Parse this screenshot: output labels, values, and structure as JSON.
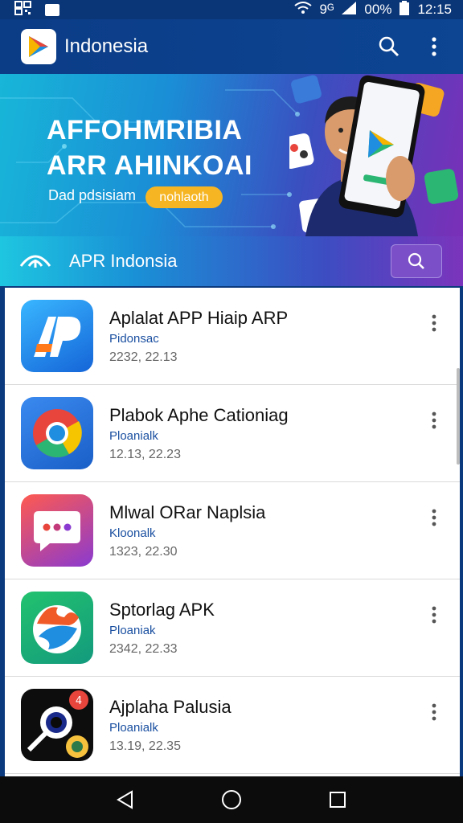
{
  "status_bar": {
    "signal_text": "9ᴳ",
    "battery_text": "00%",
    "time": "12:15"
  },
  "app_bar": {
    "title": "Indonesia"
  },
  "banner": {
    "headline_line1": "AFFOHMRIBIA",
    "headline_line2": "ARR AHINKOAI",
    "subtitle": "Dad pdsisiam",
    "pill_label": "nohlaoth"
  },
  "search_strip": {
    "title": "APR Indonsia"
  },
  "apps": [
    {
      "name": "Aplalat APP Hiaip ARP",
      "publisher": "Pidonsac",
      "date": "2232, 22.13",
      "icon": "ap-logo-icon",
      "colors": [
        "#2ba7f0",
        "#1565d8"
      ]
    },
    {
      "name": "Plabok Aphe Cationiag",
      "publisher": "Ploanialk",
      "date": "12.13, 22.23",
      "icon": "chrome-logo-icon",
      "colors": [
        "#2f7fe0",
        "#1a5fc8"
      ]
    },
    {
      "name": "Mlwal ORar Naplsia",
      "publisher": "Kloonalk",
      "date": "1323, 22.30",
      "icon": "chat-bubble-icon",
      "colors": [
        "#ff5a4f",
        "#8a3ad0"
      ]
    },
    {
      "name": "Sptorlag APK",
      "publisher": "Ploaniak",
      "date": "2342, 22.33",
      "icon": "photo-leaf-icon",
      "colors": [
        "#1fb26b",
        "#16a07f"
      ]
    },
    {
      "name": "Ajplaha Palusia",
      "publisher": "Ploanialk",
      "date": "13.19, 22.35",
      "icon": "camera-lens-icon",
      "colors": [
        "#111111",
        "#000000"
      ]
    }
  ],
  "colors": {
    "app_bar": "#0b3c86",
    "accent_pill": "#f6b623",
    "publisher_text": "#1a4fa0"
  }
}
